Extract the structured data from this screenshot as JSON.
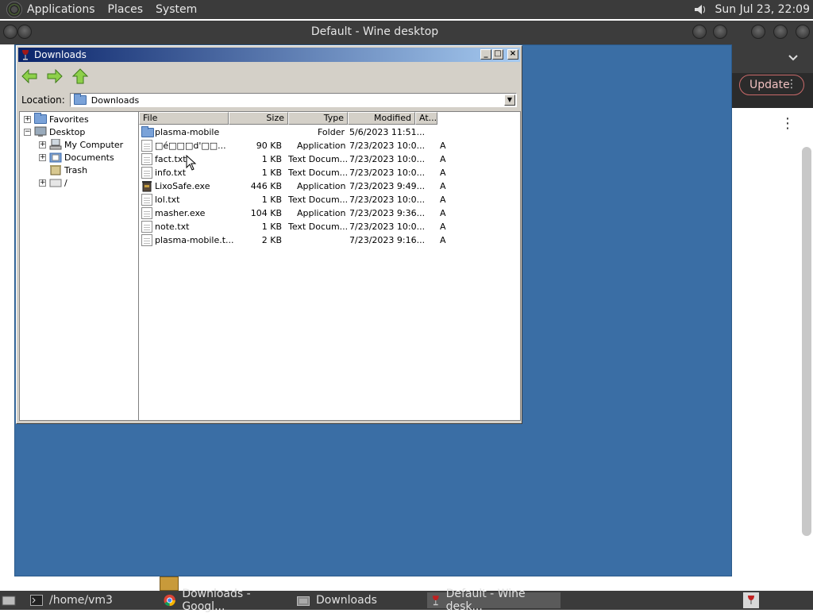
{
  "top_panel": {
    "menus": [
      "Applications",
      "Places",
      "System"
    ],
    "clock": "Sun Jul 23, 22:09"
  },
  "wine_window": {
    "title": "Default - Wine desktop"
  },
  "browser_bg": {
    "update_label": "Update",
    "menu_dots": "⋮",
    "kebab": "⋮"
  },
  "explorer": {
    "title": "Downloads",
    "location_label": "Location:",
    "location_value": "Downloads",
    "tree": [
      {
        "label": "Favorites",
        "expander": "+"
      },
      {
        "label": "Desktop",
        "expander": "−"
      },
      {
        "label": "My Computer",
        "expander": "+"
      },
      {
        "label": "Documents",
        "expander": "+"
      },
      {
        "label": "Trash",
        "expander": ""
      },
      {
        "label": "/",
        "expander": "+"
      }
    ],
    "columns": [
      "File",
      "Size",
      "Type",
      "Modified",
      "At..."
    ],
    "files": [
      {
        "name": "plasma-mobile",
        "size": "",
        "type": "Folder",
        "modified": "5/6/2023 11:51...",
        "attr": "",
        "icon": "folder-icon"
      },
      {
        "name": "□é□□□d'□□...",
        "size": "90 KB",
        "type": "Application",
        "modified": "7/23/2023 10:0...",
        "attr": "A",
        "icon": "document-icon"
      },
      {
        "name": "fact.txt",
        "size": "1 KB",
        "type": "Text Docum...",
        "modified": "7/23/2023 10:0...",
        "attr": "A",
        "icon": "document-icon"
      },
      {
        "name": "info.txt",
        "size": "1 KB",
        "type": "Text Docum...",
        "modified": "7/23/2023 10:0...",
        "attr": "A",
        "icon": "document-icon"
      },
      {
        "name": "LixoSafe.exe",
        "size": "446 KB",
        "type": "Application",
        "modified": "7/23/2023 9:49...",
        "attr": "A",
        "icon": "trash-exe-icon"
      },
      {
        "name": "lol.txt",
        "size": "1 KB",
        "type": "Text Docum...",
        "modified": "7/23/2023 10:0...",
        "attr": "A",
        "icon": "document-icon"
      },
      {
        "name": "masher.exe",
        "size": "104 KB",
        "type": "Application",
        "modified": "7/23/2023 9:36...",
        "attr": "A",
        "icon": "document-icon"
      },
      {
        "name": "note.txt",
        "size": "1 KB",
        "type": "Text Docum...",
        "modified": "7/23/2023 10:0...",
        "attr": "A",
        "icon": "document-icon"
      },
      {
        "name": "plasma-mobile.t...",
        "size": "2 KB",
        "type": "",
        "modified": "7/23/2023 9:16...",
        "attr": "A",
        "icon": "document-icon"
      }
    ]
  },
  "taskbar": {
    "items": [
      {
        "label": "/home/vm3",
        "icon": "terminal-icon"
      },
      {
        "label": "Downloads - Googl...",
        "icon": "chrome-icon"
      },
      {
        "label": "Downloads",
        "icon": "folder-icon"
      },
      {
        "label": "Default - Wine desk...",
        "icon": "wine-icon"
      }
    ]
  },
  "colors": {
    "wine_desktop": "#3a6ea5",
    "title_active": "#0a246a",
    "panel": "#3b3b3b"
  }
}
